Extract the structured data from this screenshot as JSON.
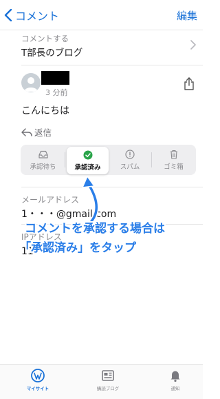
{
  "nav": {
    "back_label": "コメント",
    "edit_label": "編集"
  },
  "comment_on": {
    "label": "コメントする",
    "value": "T部長のブログ"
  },
  "comment": {
    "time": "3 分前",
    "text": "こんにちは",
    "reply_label": "返信"
  },
  "status_tabs": [
    {
      "label": "承認待ち",
      "icon": "inbox-icon",
      "selected": false
    },
    {
      "label": "承認済み",
      "icon": "check-circle-icon",
      "selected": true
    },
    {
      "label": "スパム",
      "icon": "alert-circle-icon",
      "selected": false
    },
    {
      "label": "ゴミ箱",
      "icon": "trash-icon",
      "selected": false
    }
  ],
  "fields": {
    "email_label": "メールアドレス",
    "email_value": "1・・・@gmail.com",
    "ip_label": "IPアドレス",
    "ip_value": "11"
  },
  "annotation": {
    "line1": "コメントを承認する場合は",
    "line2": "「承認済み」をタップ",
    "color": "#2a7ee8"
  },
  "tabbar": [
    {
      "label": "マイサイト",
      "icon": "wordpress-icon",
      "active": true
    },
    {
      "label": "購読ブログ",
      "icon": "reader-icon",
      "active": false
    },
    {
      "label": "通知",
      "icon": "bell-icon",
      "active": false
    }
  ],
  "colors": {
    "accent": "#1a72d8",
    "success": "#2aa44a"
  }
}
